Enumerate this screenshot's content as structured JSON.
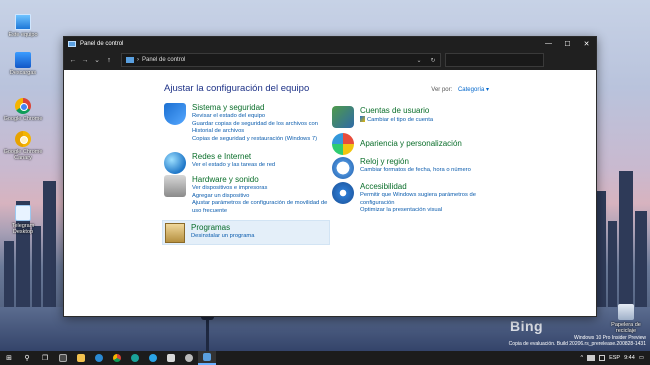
{
  "desktop": {
    "icons": [
      {
        "label": "Este equipo"
      },
      {
        "label": "Descargas"
      },
      {
        "label": "Google Chrome"
      },
      {
        "label": "Google Chrome Canary"
      },
      {
        "label": "Telegram Desktop"
      }
    ],
    "recycle_bin": "Papelera de reciclaje",
    "bing": "Bing",
    "watermark_line1": "Windows 10 Pro Insider Preview",
    "watermark_line2": "Copia de evaluación. Build 20206.rs_prerelease.200828-1431"
  },
  "window": {
    "title": "Panel de control",
    "controls": {
      "minimize": "—",
      "maximize": "☐",
      "close": "✕"
    },
    "nav": {
      "back": "←",
      "forward": "→",
      "history": "⌄",
      "up": "↑"
    },
    "address": {
      "separator": "›",
      "path": "Panel de control",
      "dropdown": "⌄",
      "refresh": "↻"
    },
    "search_placeholder": ""
  },
  "content": {
    "heading": "Ajustar la configuración del equipo",
    "view_by_label": "Ver por:",
    "view_by_value": "Categoría ▾",
    "left_categories": [
      {
        "title": "Sistema y seguridad",
        "links": [
          "Revisar el estado del equipo",
          "Guardar copias de seguridad de los archivos con Historial de archivos",
          "Copias de seguridad y restauración (Windows 7)"
        ]
      },
      {
        "title": "Redes e Internet",
        "links": [
          "Ver el estado y las tareas de red"
        ]
      },
      {
        "title": "Hardware y sonido",
        "links": [
          "Ver dispositivos e impresoras",
          "Agregar un dispositivo",
          "Ajustar parámetros de configuración de movilidad de uso frecuente"
        ]
      },
      {
        "title": "Programas",
        "links": [
          "Desinstalar un programa"
        ]
      }
    ],
    "right_categories": [
      {
        "title": "Cuentas de usuario",
        "links": [
          "Cambiar el tipo de cuenta"
        ]
      },
      {
        "title": "Apariencia y personalización",
        "links": []
      },
      {
        "title": "Reloj y región",
        "links": [
          "Cambiar formatos de fecha, hora o número"
        ]
      },
      {
        "title": "Accesibilidad",
        "links": [
          "Permitir que Windows sugiera parámetros de configuración",
          "Optimizar la presentación visual"
        ]
      }
    ]
  },
  "taskbar": {
    "start": "⊞",
    "search": "⚲",
    "task_view": "❐",
    "tray_arrow": "^",
    "time": "9:44",
    "lang": "ESP",
    "date": "",
    "notification": "▭"
  }
}
